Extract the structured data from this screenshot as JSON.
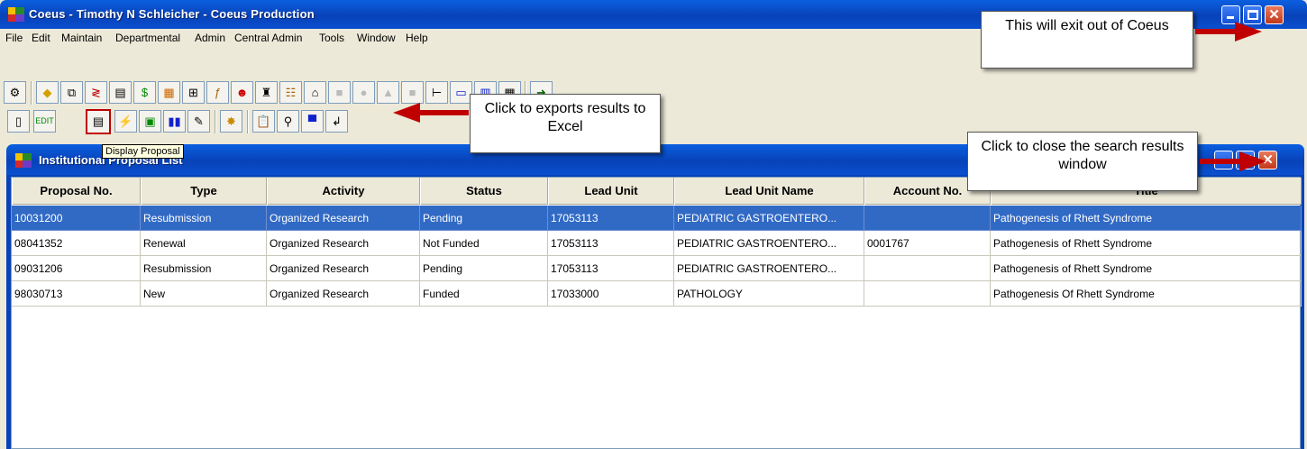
{
  "window": {
    "title": "Coeus  -  Timothy N Schleicher  -  Coeus Production"
  },
  "menu": [
    "File",
    "Edit",
    "Maintain",
    "Departmental",
    "Admin",
    "Central Admin",
    "Tools",
    "Window",
    "Help"
  ],
  "toolbar": {
    "row1_icons": [
      "proposal-icon",
      "gem-icon",
      "copy-icon",
      "sort-icon",
      "stack-icon",
      "money-bag-icon",
      "chart-icon",
      "org-icon",
      "formula-icon",
      "people-icon",
      "award-icon",
      "group-icon",
      "building-icon",
      "disabled-icon",
      "disabled-icon",
      "disabled-icon",
      "disabled-icon",
      "tree-icon",
      "window-icon",
      "columns-icon",
      "calendar-icon",
      "exit-icon"
    ],
    "row2_icons": [
      "document-icon",
      "edit-icon",
      "display-proposal-icon",
      "flash-icon",
      "image-icon",
      "binoculars-icon",
      "notes-icon",
      "burst-icon",
      "clipboard-icon",
      "search-icon",
      "save-icon",
      "close-icon"
    ],
    "tooltip": "Display Proposal"
  },
  "inner_window": {
    "title": "Institutional Proposal List"
  },
  "table": {
    "columns": [
      "Proposal No.",
      "Type",
      "Activity",
      "Status",
      "Lead Unit",
      "Lead Unit Name",
      "Account No.",
      "Title"
    ],
    "rows": [
      [
        "10031200",
        "Resubmission",
        "Organized Research",
        "Pending",
        "17053113",
        "PEDIATRIC GASTROENTERO...",
        "",
        "Pathogenesis of Rhett Syndrome"
      ],
      [
        "08041352",
        "Renewal",
        "Organized Research",
        "Not Funded",
        "17053113",
        "PEDIATRIC GASTROENTERO...",
        "0001767",
        "Pathogenesis of Rhett Syndrome"
      ],
      [
        "09031206",
        "Resubmission",
        "Organized Research",
        "Pending",
        "17053113",
        "PEDIATRIC GASTROENTERO...",
        "",
        "Pathogenesis of Rhett Syndrome"
      ],
      [
        "98030713",
        "New",
        "Organized Research",
        "Funded",
        "17033000",
        "PATHOLOGY",
        "",
        "Pathogenesis Of Rhett Syndrome"
      ]
    ],
    "selected_row": 0
  },
  "callouts": {
    "exit": "This will exit out of Coeus",
    "export": "Click to exports results to Excel",
    "close_search": "Click to close the search results window"
  },
  "colors": {
    "titlebar": "#0842b8",
    "selection": "#316ac5",
    "arrow": "#c00000"
  }
}
